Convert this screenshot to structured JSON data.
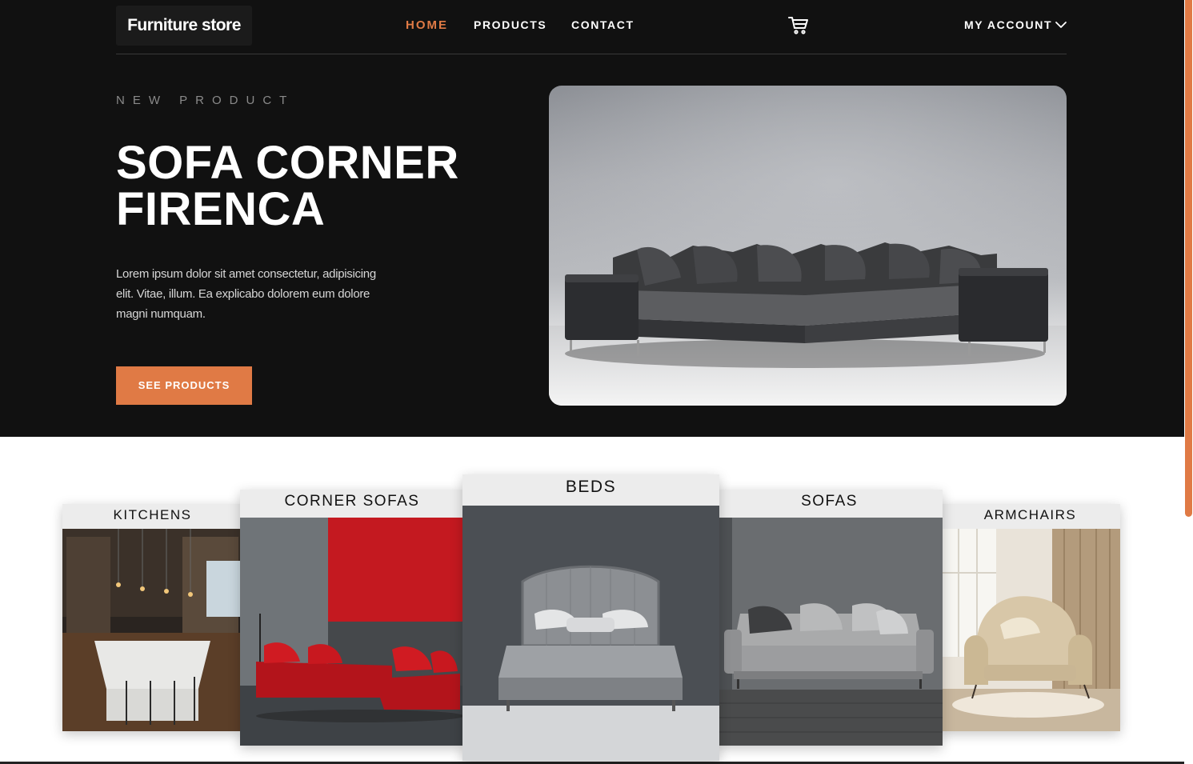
{
  "header": {
    "logo": "Furniture store",
    "nav": {
      "home": "HOME",
      "products": "PRODUCTS",
      "contact": "CONTACT"
    },
    "cart_icon": "shopping-cart-icon",
    "account": "MY ACCOUNT",
    "account_icon": "chevron-down-icon"
  },
  "hero": {
    "eyebrow": "NEW PRODUCT",
    "title_line1": "SOFA CORNER",
    "title_line2": "FIRENCA",
    "description": "Lorem ipsum dolor sit amet consectetur, adipisicing elit. Vitae, illum. Ea explicabo dolorem eum dolore magni numquam.",
    "cta": "SEE PRODUCTS"
  },
  "categories": [
    {
      "label": "KITCHENS"
    },
    {
      "label": "CORNER SOFAS"
    },
    {
      "label": "BEDS"
    },
    {
      "label": "SOFAS"
    },
    {
      "label": "ARMCHAIRS"
    }
  ],
  "colors": {
    "accent": "#e07a45",
    "hero_bg": "#111111",
    "text_light": "#ffffff",
    "muted": "#8a8a8a"
  }
}
